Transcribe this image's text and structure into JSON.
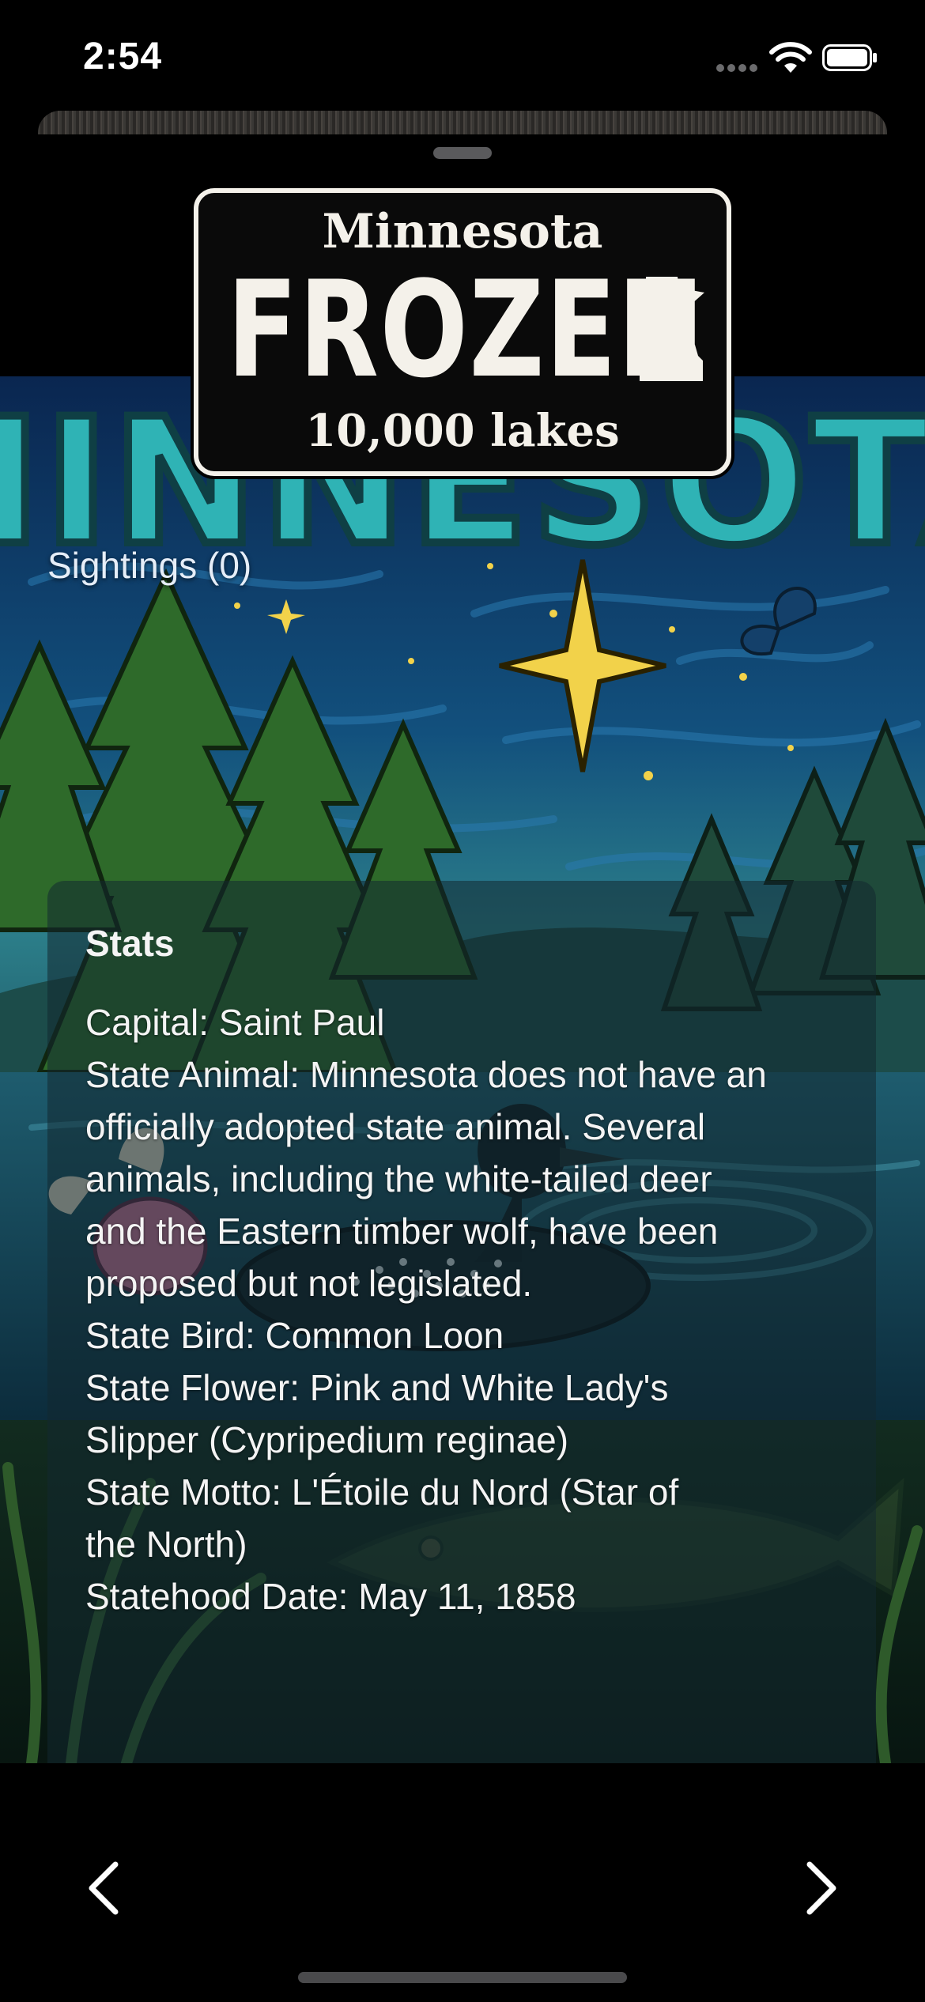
{
  "status_bar": {
    "time": "2:54"
  },
  "plate": {
    "state": "Minnesota",
    "main_text": "FROZEN",
    "slogan": "10,000 lakes",
    "icon": "minnesota-state-silhouette-icon"
  },
  "artwork": {
    "banner_text": "MINNESOTA"
  },
  "sightings": {
    "label": "Sightings (0)"
  },
  "stats": {
    "title": "Stats",
    "lines": [
      "Capital: Saint Paul",
      "State Animal: Minnesota does not have an",
      "officially adopted state animal. Several",
      "animals, including the white-tailed deer",
      "and the Eastern timber wolf, have been",
      "proposed but not legislated.",
      "State Bird: Common Loon",
      "State Flower: Pink and White Lady's",
      "Slipper (Cypripedium reginae)",
      "State Motto: L'Étoile du Nord (Star of",
      "the North)",
      "Statehood Date: May 11, 1858"
    ]
  },
  "navigation": {
    "prev_icon": "chevron-left-icon",
    "next_icon": "chevron-right-icon"
  },
  "colors": {
    "plate_background": "#0a0a0a",
    "plate_text": "#f4f1ea",
    "sky_deep": "#0b2d57",
    "banner_teal": "#2fb3b5",
    "star_yellow": "#f2d24a"
  }
}
